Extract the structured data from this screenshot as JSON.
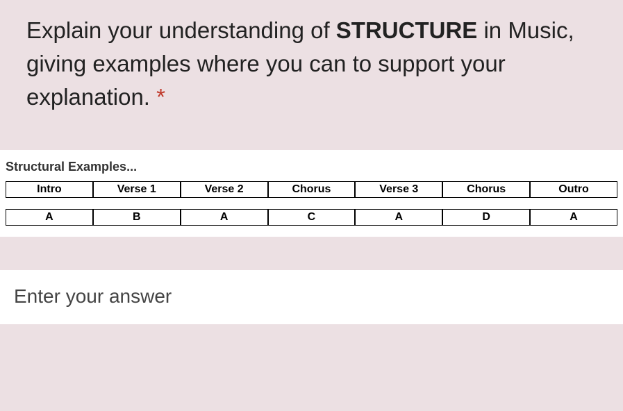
{
  "question": {
    "part1": "Explain your understanding of ",
    "bold": "STRUCTURE",
    "part2": " in Music, giving examples where you can to support your explanation. ",
    "required_mark": "*"
  },
  "examples": {
    "title": "Structural Examples...",
    "row1": [
      "Intro",
      "Verse 1",
      "Verse 2",
      "Chorus",
      "Verse 3",
      "Chorus",
      "Outro"
    ],
    "row2": [
      "A",
      "B",
      "A",
      "C",
      "A",
      "D",
      "A"
    ]
  },
  "answer": {
    "placeholder": "Enter your answer",
    "value": ""
  }
}
